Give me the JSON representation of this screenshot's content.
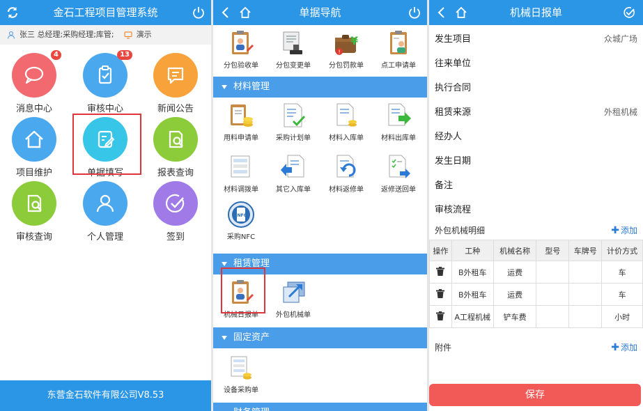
{
  "panel1": {
    "title": "金石工程项目管理系统",
    "user_info": "张三 总经理;采购经理;库管;",
    "demo_label": "演示",
    "tiles": [
      {
        "label": "消息中心",
        "badge": "4",
        "color": "#f26a6f",
        "icon": "chat-bubble-icon"
      },
      {
        "label": "审核中心",
        "badge": "13",
        "color": "#4aa8ee",
        "icon": "clipboard-check-icon"
      },
      {
        "label": "新闻公告",
        "badge": "",
        "color": "#f7a23b",
        "icon": "message-lines-icon"
      },
      {
        "label": "项目维护",
        "badge": "",
        "color": "#4aa8ee",
        "icon": "home-icon"
      },
      {
        "label": "单据填写",
        "badge": "",
        "color": "#38c6e8",
        "icon": "edit-document-icon"
      },
      {
        "label": "报表查询",
        "badge": "",
        "color": "#8ccc3a",
        "icon": "document-search-icon"
      },
      {
        "label": "审核查询",
        "badge": "",
        "color": "#8ccc3a",
        "icon": "document-search-icon"
      },
      {
        "label": "个人管理",
        "badge": "",
        "color": "#4aa8ee",
        "icon": "user-icon"
      },
      {
        "label": "签到",
        "badge": "",
        "color": "#a07be8",
        "icon": "check-circle-icon"
      }
    ],
    "footer": "东营金石软件有限公司V8.53"
  },
  "panel2": {
    "title": "单据导航",
    "top_items": [
      "分包验收单",
      "分包变更单",
      "分包罚款单",
      "点工申请单"
    ],
    "sections": [
      {
        "name": "材料管理",
        "items": [
          "用料申请单",
          "采购计划单",
          "材料入库单",
          "材料出库单",
          "材料调拨单",
          "其它入库单",
          "材料返修单",
          "返修送回单",
          "采购NFC"
        ]
      },
      {
        "name": "租赁管理",
        "items": [
          "机械日报单",
          "外包机械单"
        ]
      },
      {
        "name": "固定资产",
        "items": [
          "设备采购单"
        ]
      },
      {
        "name": "财务管理",
        "items": []
      }
    ]
  },
  "panel3": {
    "title": "机械日报单",
    "fields": [
      {
        "label": "发生项目",
        "value": "众城广场"
      },
      {
        "label": "往来单位",
        "value": ""
      },
      {
        "label": "执行合同",
        "value": ""
      },
      {
        "label": "租赁来源",
        "value": "外租机械"
      },
      {
        "label": "经办人",
        "value": ""
      },
      {
        "label": "发生日期",
        "value": ""
      },
      {
        "label": "备注",
        "value": ""
      },
      {
        "label": "审核流程",
        "value": ""
      }
    ],
    "detail_title": "外包机械明细",
    "add_label": "添加",
    "table_headers": [
      "操作",
      "工种",
      "机械名称",
      "型号",
      "车牌号",
      "计价方式"
    ],
    "table_rows": [
      [
        "",
        "B外租车",
        "运费",
        "",
        "",
        "车"
      ],
      [
        "",
        "B外租车",
        "运费",
        "",
        "",
        "车"
      ],
      [
        "",
        "A工程机械",
        "铲车费",
        "",
        "",
        "小时"
      ]
    ],
    "attachment_label": "附件",
    "save_label": "保存"
  }
}
